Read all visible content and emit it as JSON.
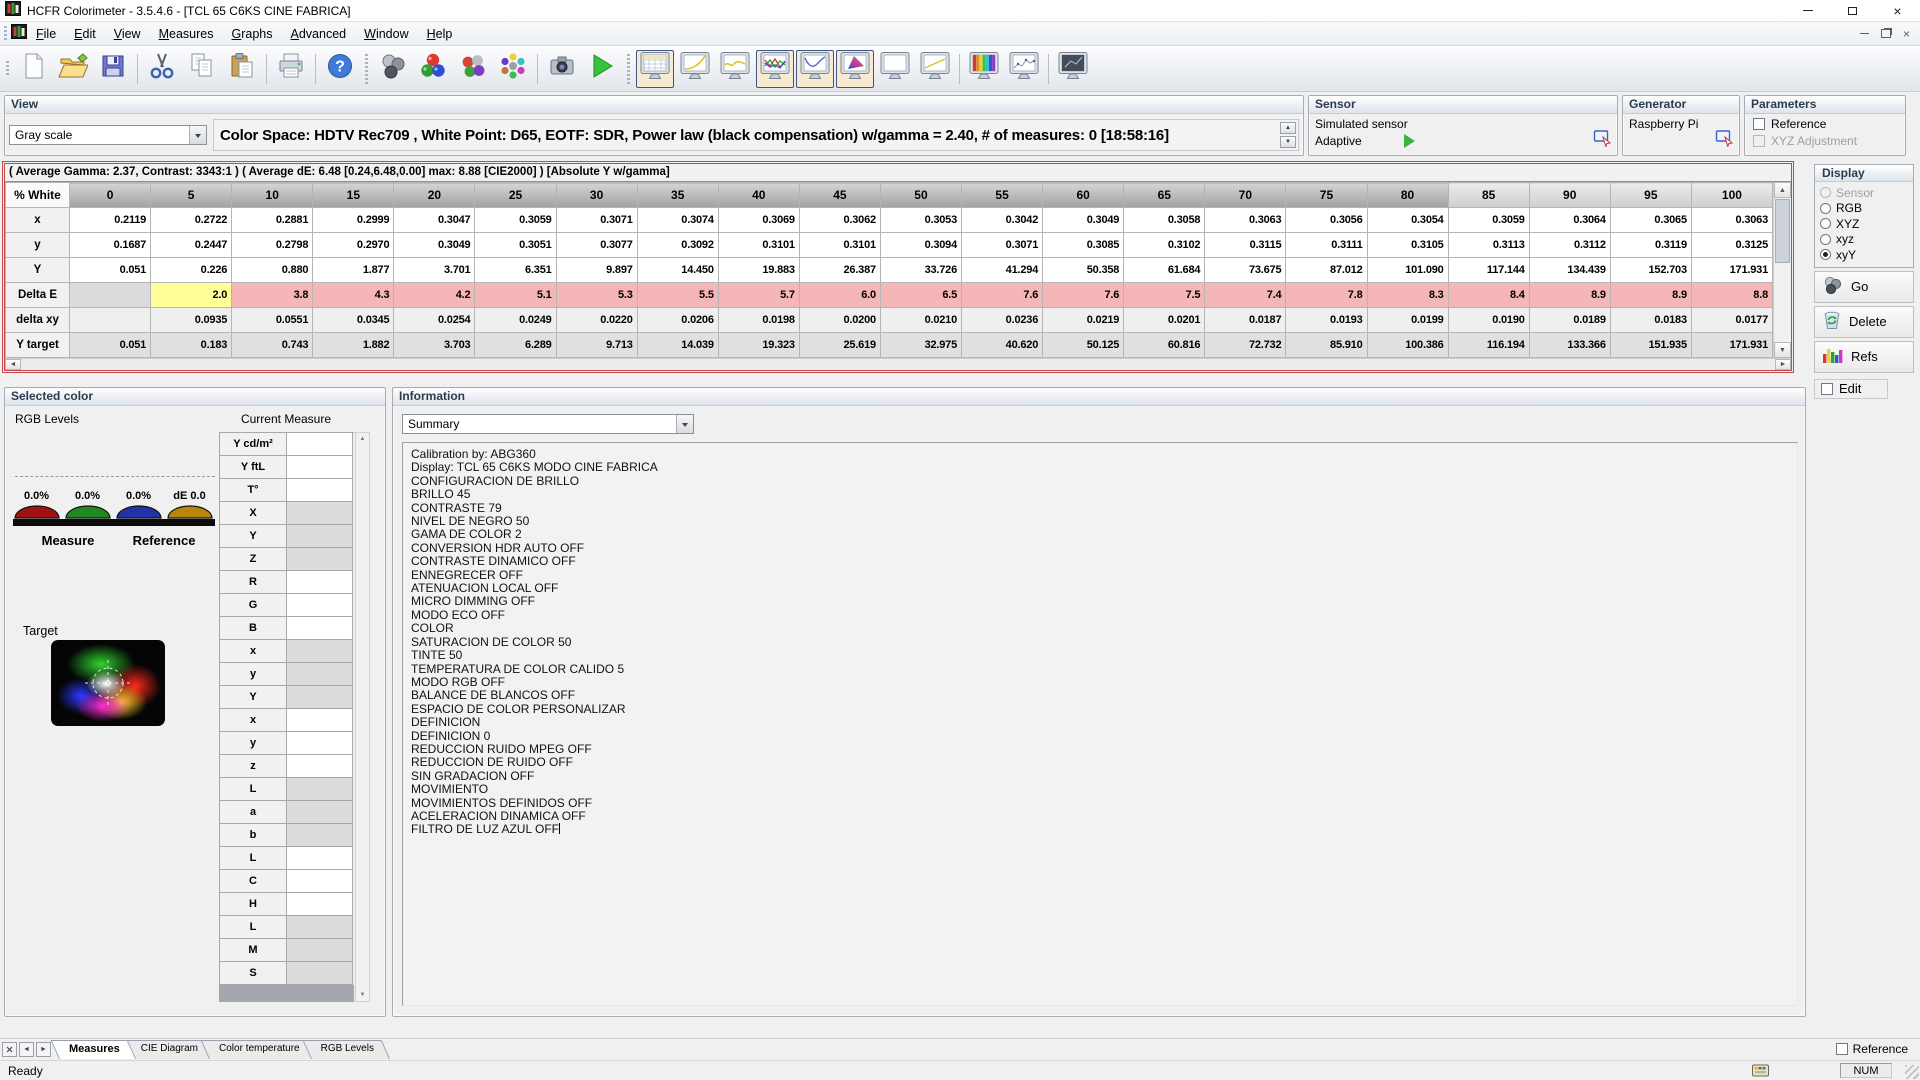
{
  "window": {
    "title": "HCFR Colorimeter - 3.5.4.6 - [TCL 65 C6KS CINE FABRICA]"
  },
  "menu": {
    "items": [
      "File",
      "Edit",
      "View",
      "Measures",
      "Graphs",
      "Advanced",
      "Window",
      "Help"
    ]
  },
  "toolbar": {
    "buttons": [
      {
        "icon": "new-file-icon"
      },
      {
        "icon": "open-file-icon"
      },
      {
        "icon": "save-icon"
      },
      {
        "sep": true
      },
      {
        "icon": "cut-icon"
      },
      {
        "icon": "copy-icon"
      },
      {
        "icon": "paste-icon"
      },
      {
        "sep": true
      },
      {
        "icon": "print-icon"
      },
      {
        "sep": true
      },
      {
        "icon": "help-icon"
      },
      {
        "group": true
      },
      {
        "icon": "sensor-settings-icon"
      },
      {
        "icon": "measure-rgb-icon"
      },
      {
        "icon": "measure-colors-icon"
      },
      {
        "icon": "measure-continuous-icon"
      },
      {
        "sep": true
      },
      {
        "icon": "snapshot-icon"
      },
      {
        "icon": "run-measures-icon"
      },
      {
        "group": true
      },
      {
        "icon": "view-measures-grid-icon",
        "selected": true
      },
      {
        "icon": "view-gamma-chart-icon"
      },
      {
        "icon": "view-luminance-chart-icon"
      },
      {
        "icon": "view-rgb-levels-chart-icon",
        "selected": true
      },
      {
        "icon": "view-deltae-chart-icon",
        "selected": true
      },
      {
        "icon": "view-cie-diagram-icon",
        "selected": true
      },
      {
        "icon": "view-blank-chart-icon"
      },
      {
        "icon": "view-gamma2-chart-icon"
      },
      {
        "sep": true
      },
      {
        "icon": "view-gradient-chart-icon"
      },
      {
        "icon": "view-histogram-chart-icon"
      },
      {
        "sep": true
      },
      {
        "icon": "view-3d-chart-icon"
      }
    ]
  },
  "view_panel": {
    "title": "View",
    "mode_value": "Gray scale",
    "summary": "Color Space: HDTV Rec709 , White Point: D65, EOTF:  SDR, Power law (black compensation) w/gamma = 2.40, # of measures: 0 [18:58:16]"
  },
  "sensor_panel": {
    "title": "Sensor",
    "name": "Simulated sensor",
    "mode": "Adaptive"
  },
  "generator_panel": {
    "title": "Generator",
    "name": "Raspberry Pi"
  },
  "parameters_panel": {
    "title": "Parameters",
    "options": [
      {
        "label": "Reference",
        "checked": false,
        "disabled": false
      },
      {
        "label": "XYZ Adjustment",
        "checked": false,
        "disabled": true
      }
    ]
  },
  "grid": {
    "info_line": "( Average Gamma: 2.37, Contrast: 3343:1 ) ( Average dE: 6.48 [0.24,6.48,0.00] max: 8.88 [CIE2000] ) [Absolute Y w/gamma]",
    "corner": "% White",
    "columns": [
      "0",
      "5",
      "10",
      "15",
      "20",
      "25",
      "30",
      "35",
      "40",
      "45",
      "50",
      "55",
      "60",
      "65",
      "70",
      "75",
      "80",
      "85",
      "90",
      "95",
      "100"
    ],
    "rows": [
      {
        "label": "x",
        "type": "white",
        "values": [
          "0.2119",
          "0.2722",
          "0.2881",
          "0.2999",
          "0.3047",
          "0.3059",
          "0.3071",
          "0.3074",
          "0.3069",
          "0.3062",
          "0.3053",
          "0.3042",
          "0.3049",
          "0.3058",
          "0.3063",
          "0.3056",
          "0.3054",
          "0.3059",
          "0.3064",
          "0.3065",
          "0.3063"
        ]
      },
      {
        "label": "y",
        "type": "white",
        "values": [
          "0.1687",
          "0.2447",
          "0.2798",
          "0.2970",
          "0.3049",
          "0.3051",
          "0.3077",
          "0.3092",
          "0.3101",
          "0.3101",
          "0.3094",
          "0.3071",
          "0.3085",
          "0.3102",
          "0.3115",
          "0.3111",
          "0.3105",
          "0.3113",
          "0.3112",
          "0.3119",
          "0.3125"
        ]
      },
      {
        "label": "Y",
        "type": "white",
        "values": [
          "0.051",
          "0.226",
          "0.880",
          "1.877",
          "3.701",
          "6.351",
          "9.897",
          "14.450",
          "19.883",
          "26.387",
          "33.726",
          "41.294",
          "50.358",
          "61.684",
          "73.675",
          "87.012",
          "101.090",
          "117.144",
          "134.439",
          "152.703",
          "171.931"
        ]
      },
      {
        "label": "Delta E",
        "type": "deltae",
        "values": [
          "",
          "2.0",
          "3.8",
          "4.3",
          "4.2",
          "5.1",
          "5.3",
          "5.5",
          "5.7",
          "6.0",
          "6.5",
          "7.6",
          "7.6",
          "7.5",
          "7.4",
          "7.8",
          "8.3",
          "8.4",
          "8.9",
          "8.9",
          "8.8"
        ]
      },
      {
        "label": "delta xy",
        "type": "lightgray",
        "values": [
          "",
          "0.0935",
          "0.0551",
          "0.0345",
          "0.0254",
          "0.0249",
          "0.0220",
          "0.0206",
          "0.0198",
          "0.0200",
          "0.0210",
          "0.0236",
          "0.0219",
          "0.0201",
          "0.0187",
          "0.0193",
          "0.0199",
          "0.0190",
          "0.0189",
          "0.0183",
          "0.0177"
        ]
      },
      {
        "label": "Y target",
        "type": "gray",
        "values": [
          "0.051",
          "0.183",
          "0.743",
          "1.882",
          "3.703",
          "6.289",
          "9.713",
          "14.039",
          "19.323",
          "25.619",
          "32.975",
          "40.620",
          "50.125",
          "60.816",
          "72.732",
          "85.910",
          "100.386",
          "116.194",
          "133.366",
          "151.935",
          "171.931"
        ]
      }
    ],
    "colors": {
      "delta_ok": "#ffff99",
      "delta_bad": "#f4b6b6",
      "frame": "#c24a4a"
    }
  },
  "display_panel": {
    "title": "Display",
    "options": [
      {
        "label": "Sensor",
        "disabled": true,
        "selected": false
      },
      {
        "label": "RGB",
        "disabled": false,
        "selected": false
      },
      {
        "label": "XYZ",
        "disabled": false,
        "selected": false
      },
      {
        "label": "xyz",
        "disabled": false,
        "selected": false
      },
      {
        "label": "xyY",
        "disabled": false,
        "selected": true
      }
    ],
    "buttons": [
      {
        "label": "Go",
        "icon": "go-sensor-icon"
      },
      {
        "label": "Delete",
        "icon": "delete-icon"
      },
      {
        "label": "Refs",
        "icon": "refs-icon"
      }
    ],
    "edit": {
      "label": "Edit",
      "checked": false
    }
  },
  "selected_color": {
    "title": "Selected color",
    "rgb_levels_label": "RGB Levels",
    "current_measure_label": "Current Measure",
    "gauges": [
      {
        "label": "0.0%",
        "color": "#a01212"
      },
      {
        "label": "0.0%",
        "color": "#1f8a1f"
      },
      {
        "label": "0.0%",
        "color": "#2233aa"
      },
      {
        "label": "dE 0.0",
        "color": "#b8860b"
      }
    ],
    "measure_label": "Measure",
    "reference_label": "Reference",
    "target_label": "Target",
    "measure_rows": [
      "Y cd/m²",
      "Y ftL",
      "T°",
      "X",
      "Y",
      "Z",
      "R",
      "G",
      "B",
      "x",
      "y",
      "Y",
      "x",
      "y",
      "z",
      "L",
      "a",
      "b",
      "L",
      "C",
      "H",
      "L",
      "M",
      "S"
    ]
  },
  "information": {
    "title": "Information",
    "selector_value": "Summary",
    "lines": [
      "Calibration by: ABG360",
      "Display: TCL 65 C6KS MODO CINE FABRICA",
      "CONFIGURACION DE BRILLO",
      "BRILLO 45",
      "CONTRASTE 79",
      "NIVEL DE NEGRO 50",
      "GAMA DE COLOR 2",
      "CONVERSION HDR AUTO OFF",
      "CONTRASTE DINAMICO OFF",
      "ENNEGRECER OFF",
      "ATENUACION LOCAL OFF",
      "MICRO DIMMING OFF",
      "MODO ECO OFF",
      "COLOR",
      "SATURACION DE COLOR 50",
      "TINTE 50",
      "TEMPERATURA DE COLOR CALIDO 5",
      "MODO RGB OFF",
      "BALANCE DE BLANCOS OFF",
      "ESPACIO DE COLOR PERSONALIZAR",
      "DEFINICION",
      "DEFINICION 0",
      "REDUCCION RUIDO MPEG OFF",
      "REDUCCION DE RUIDO OFF",
      "SIN GRADACION OFF",
      "MOVIMIENTO",
      "MOVIMIENTOS DEFINIDOS OFF",
      "ACELERACION DINAMICA OFF",
      "FILTRO DE LUZ AZUL OFF"
    ]
  },
  "tab_bar": {
    "tabs": [
      {
        "label": "Measures",
        "active": true
      },
      {
        "label": "CIE Diagram",
        "active": false
      },
      {
        "label": "Color temperature",
        "active": false
      },
      {
        "label": "RGB Levels",
        "active": false
      }
    ],
    "reference_checkbox": "Reference"
  },
  "status_bar": {
    "left": "Ready",
    "num": "NUM"
  }
}
